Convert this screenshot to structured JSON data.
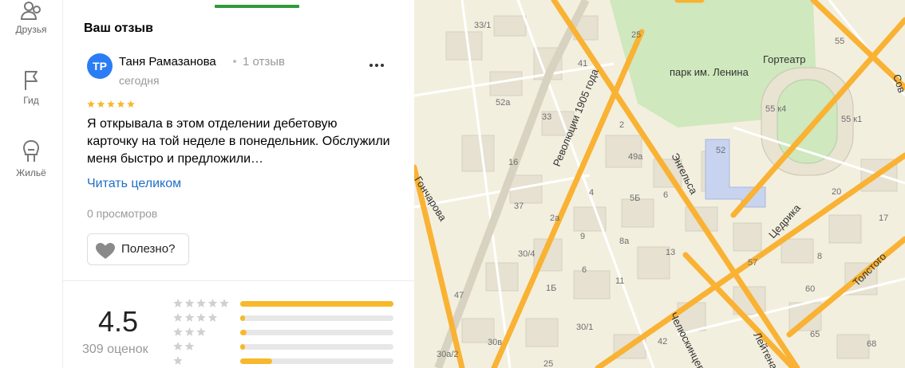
{
  "rail": {
    "items": [
      {
        "label": "Друзья",
        "icon": "friends-icon"
      },
      {
        "label": "Гид",
        "icon": "flag-icon"
      },
      {
        "label": "Жильё",
        "icon": "housing-icon"
      }
    ]
  },
  "review": {
    "section_title": "Ваш отзыв",
    "avatar_initials": "ТР",
    "author": "Таня Рамазанова",
    "author_reviews": "1 отзыв",
    "date": "сегодня",
    "stars": 5,
    "text": "Я открывала в этом отделении дебетовую карточку на той неделе в понедельник. Обслужили меня быстро и предложили…",
    "read_more": "Читать целиком",
    "views": "0 просмотров",
    "useful_label": "Полезно?"
  },
  "rating": {
    "value": "4.5",
    "count": "309 оценок",
    "distribution": [
      {
        "stars": 5,
        "fraction": 1.0
      },
      {
        "stars": 4,
        "fraction": 0.03
      },
      {
        "stars": 3,
        "fraction": 0.04
      },
      {
        "stars": 2,
        "fraction": 0.03
      },
      {
        "stars": 1,
        "fraction": 0.21
      }
    ]
  },
  "colors": {
    "accent_green": "#2e9b3a",
    "avatar_blue": "#2a7df5",
    "link_blue": "#1f6fc7",
    "star_gold": "#f7b92b",
    "road": "#f9b233",
    "park": "#cfe8bd"
  },
  "map": {
    "places": [
      "парк им. Ленина",
      "Гортеатр"
    ],
    "streets": [
      "Революции 1905 года",
      "Энгельса",
      "Цедрика",
      "Толстого",
      "Челюскинцев",
      "Лейтенанта",
      "Гончарова",
      "Сов"
    ],
    "house_numbers": [
      "33/1",
      "25",
      "55",
      "41",
      "52а",
      "33",
      "55 к4",
      "55 к1",
      "2",
      "49а",
      "52",
      "16",
      "4",
      "6",
      "37",
      "5Б",
      "20",
      "2а",
      "9",
      "8а",
      "17",
      "30/4",
      "13",
      "57",
      "8",
      "6",
      "11",
      "1Б",
      "60",
      "47",
      "30/1",
      "65",
      "30в",
      "42",
      "68",
      "30а/2",
      "25"
    ]
  }
}
